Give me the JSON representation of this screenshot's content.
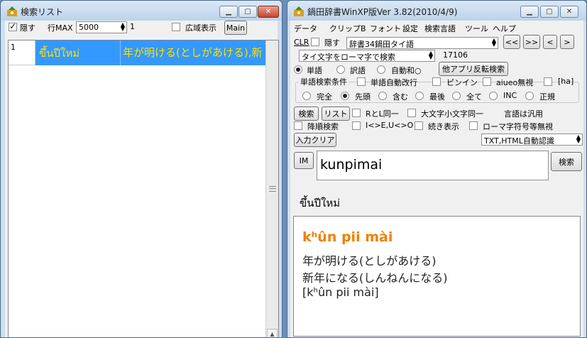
{
  "left": {
    "title": "検索リスト",
    "hide_label": "隠す",
    "rowmax_label": "行MAX",
    "rowmax_value": "5000",
    "count_value": "1",
    "wide_label": "広域表示",
    "main_button": "Main",
    "rows": [
      {
        "num": "1",
        "thai": "ขึ้นปีใหม่",
        "jp": "年が明ける(としがあける),新"
      }
    ]
  },
  "right": {
    "title": "鍋田辞書WinXP版Ver 3.82(2010/4/9)",
    "menu": [
      "データ",
      "クリップB",
      "フォント",
      "設定",
      "検索言語",
      "ツール",
      "ヘルプ"
    ],
    "clr_label": "CLR",
    "hide_label": "隠す",
    "dict_value": "辞書34鍋田タイ語",
    "nav": [
      "<<",
      ">>",
      "<",
      ">"
    ],
    "mode_value": "タイ文字をローマ字で検索",
    "count": "17106",
    "radio_word": "単語",
    "radio_trans": "訳語",
    "radio_auto": "自動和○",
    "reverse_button": "他アプリ反転検索",
    "cond_label": "単語検索条件",
    "auto_newline": "単語自動改行",
    "pinyin": "ピンイン",
    "aiueo": "aiueo無視",
    "ha": "[ha]",
    "match": [
      "完全",
      "先頭",
      "含む",
      "最後",
      "全て",
      "INC",
      "正規"
    ],
    "search_button": "検索",
    "list_button": "リスト",
    "rl_same": "RとL同一",
    "case_same": "大文字小文字同一",
    "lang_note": "言語は汎用",
    "desc_search": "降順検索",
    "ke": "I<>E,U<>O",
    "continue_show": "続き表示",
    "roman_ignore": "ローマ字符号等無視",
    "input_clear": "入力クリア",
    "txt_mode": "TXT,HTML自動認識",
    "im_button": "IM",
    "input_value": "kunpimai",
    "search_btn2": "検索",
    "thai_label": "ขึ้นปีใหม่",
    "headword": "kʰûn pii mài",
    "meanings": [
      "年が明ける(としがあける)",
      "新年になる(しんねんになる)",
      "[kʰûn pii mài]"
    ]
  }
}
